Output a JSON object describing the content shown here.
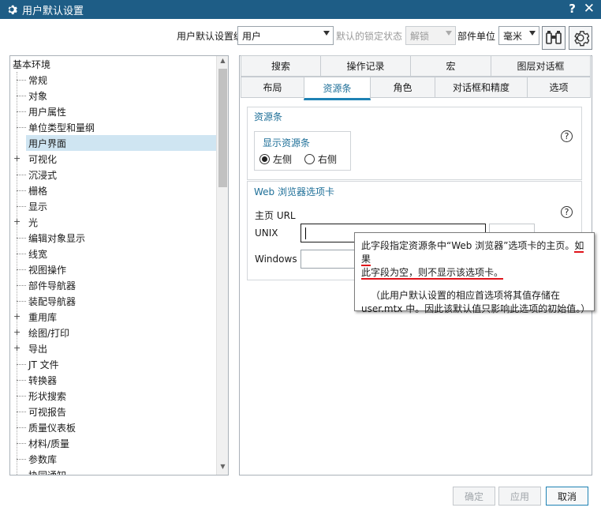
{
  "window": {
    "title": "用户默认设置",
    "help": "?",
    "close": "✕"
  },
  "toolbar": {
    "level_label": "用户默认设置级别",
    "level_value": "用户",
    "lock_label": "默认的锁定状态",
    "lock_value": "解锁",
    "unit_label": "部件单位",
    "unit_value": "毫米"
  },
  "tree": {
    "root": "基本环境",
    "items": [
      {
        "label": "常规",
        "expandable": false
      },
      {
        "label": "对象",
        "expandable": false
      },
      {
        "label": "用户属性",
        "expandable": false
      },
      {
        "label": "单位类型和量纲",
        "expandable": false
      },
      {
        "label": "用户界面",
        "expandable": false,
        "selected": true
      },
      {
        "label": "可视化",
        "expandable": true
      },
      {
        "label": "沉浸式",
        "expandable": false
      },
      {
        "label": "栅格",
        "expandable": false
      },
      {
        "label": "显示",
        "expandable": false
      },
      {
        "label": "光",
        "expandable": true
      },
      {
        "label": "编辑对象显示",
        "expandable": false
      },
      {
        "label": "线宽",
        "expandable": false
      },
      {
        "label": "视图操作",
        "expandable": false
      },
      {
        "label": "部件导航器",
        "expandable": false
      },
      {
        "label": "装配导航器",
        "expandable": false
      },
      {
        "label": "重用库",
        "expandable": true
      },
      {
        "label": "绘图/打印",
        "expandable": true
      },
      {
        "label": "导出",
        "expandable": true
      },
      {
        "label": "JT 文件",
        "expandable": false
      },
      {
        "label": "转换器",
        "expandable": false
      },
      {
        "label": "形状搜索",
        "expandable": false
      },
      {
        "label": "可视报告",
        "expandable": false
      },
      {
        "label": "质量仪表板",
        "expandable": false
      },
      {
        "label": "材料/质量",
        "expandable": false
      },
      {
        "label": "参数库",
        "expandable": false
      },
      {
        "label": "协同通知",
        "expandable": false
      }
    ]
  },
  "tabs_row1": [
    "搜索",
    "操作记录",
    "宏",
    "图层对话框"
  ],
  "tabs_row2": [
    "布局",
    "资源条",
    "角色",
    "对话框和精度",
    "选项"
  ],
  "active_tab": "资源条",
  "resource_bar": {
    "group_title": "资源条",
    "sub_title": "显示资源条",
    "left": "左侧",
    "right": "右侧",
    "selected": "左侧"
  },
  "web_browser": {
    "group_title": "Web 浏览器选项卡",
    "home_url_label": "主页 URL",
    "unix_label": "UNIX",
    "unix_value": "",
    "windows_label": "Windows",
    "windows_value": ""
  },
  "tooltip": {
    "line1_a": "此字段指定资源条中“Web 浏览器”选项卡的主页。",
    "line1_b": "如果",
    "line2": "此字段为空，则不显示该选项卡。",
    "para2": "（此用户默认设置的相应首选项将其值存储在 user.mtx 中。因此该默认值只影响此选项的初始值。）"
  },
  "buttons": {
    "ok": "确定",
    "apply": "应用",
    "cancel": "取消"
  },
  "colors": {
    "titlebar": "#1e5d86",
    "accent": "#1e82b4",
    "highlight": "#e0131a"
  }
}
